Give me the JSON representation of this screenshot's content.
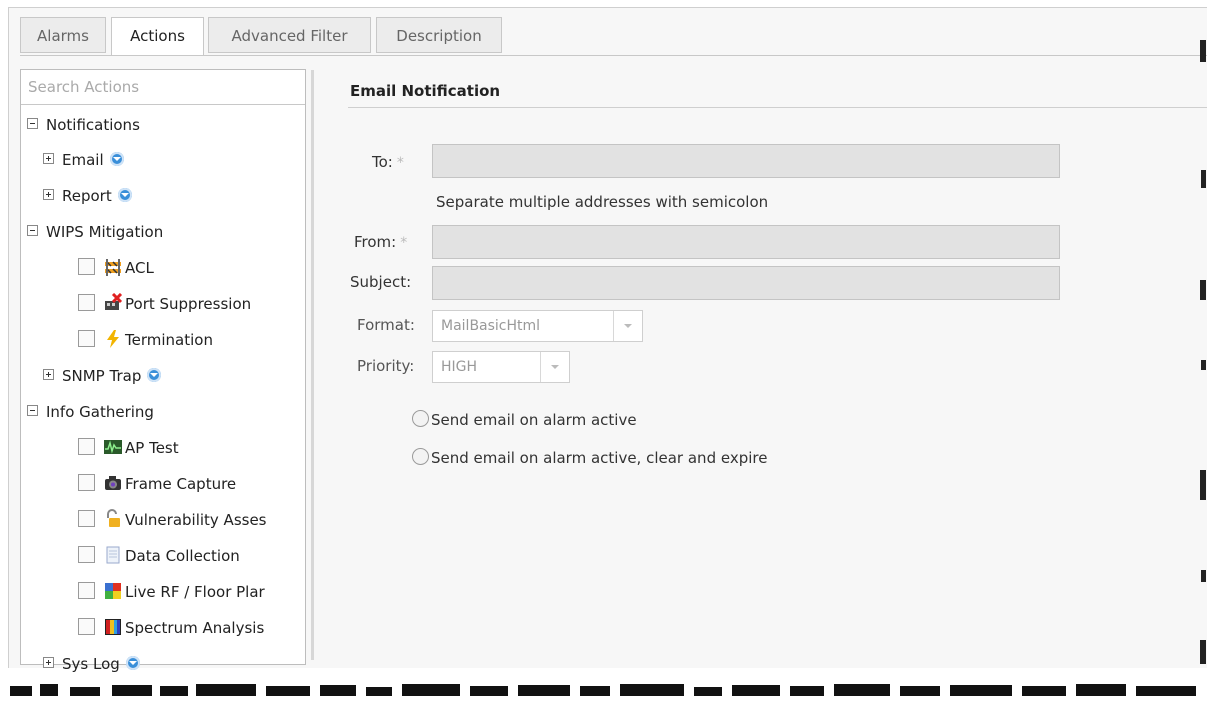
{
  "tabs": [
    {
      "label": "Alarms",
      "active": false
    },
    {
      "label": "Actions",
      "active": true
    },
    {
      "label": "Advanced Filter",
      "active": false
    },
    {
      "label": "Description",
      "active": false
    }
  ],
  "search": {
    "placeholder": "Search Actions"
  },
  "tree": {
    "notifications": "Notifications",
    "email": "Email",
    "report": "Report",
    "wips": "WIPS Mitigation",
    "acl": "ACL",
    "port_suppression": "Port Suppression",
    "termination": "Termination",
    "snmp": "SNMP Trap",
    "info": "Info Gathering",
    "ap_test": "AP Test",
    "frame_capture": "Frame Capture",
    "vulnerability": "Vulnerability Asses",
    "data_collection": "Data Collection",
    "live_rf": "Live RF / Floor Plar",
    "spectrum": "Spectrum Analysis",
    "syslog": "Sys Log"
  },
  "form": {
    "title": "Email Notification",
    "to_label": "To:",
    "hint": "Separate multiple addresses with semicolon",
    "from_label": "From:",
    "subject_label": "Subject:",
    "format_label": "Format:",
    "format_value": "MailBasicHtml",
    "priority_label": "Priority:",
    "priority_value": "HIGH",
    "required_mark": "*",
    "radio1": "Send email on alarm active",
    "radio2": "Send email on alarm active, clear and expire"
  },
  "colors": {
    "accent": "#3a8fd9",
    "field_bg": "#e2e2e2",
    "panel_bg": "#f7f7f7"
  }
}
